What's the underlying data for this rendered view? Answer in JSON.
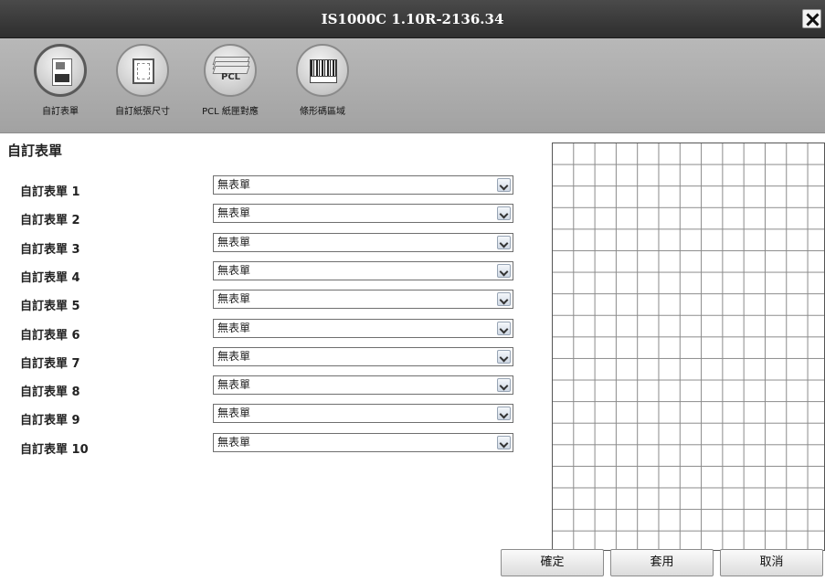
{
  "window": {
    "title": "IS1000C 1.10R-2136.34"
  },
  "toolbar": {
    "items": [
      {
        "label": "自訂表單",
        "icon": "form-icon",
        "active": true
      },
      {
        "label": "自訂紙張尺寸",
        "icon": "paper-size-icon",
        "active": false
      },
      {
        "label": "PCL 紙匣對應",
        "icon": "pcl-tray-icon",
        "active": false
      },
      {
        "label": "條形碼區域",
        "icon": "barcode-icon",
        "active": false
      }
    ]
  },
  "main": {
    "section_title": "自訂表單",
    "forms": [
      {
        "label": "自訂表單 1",
        "value": "無表單"
      },
      {
        "label": "自訂表單 2",
        "value": "無表單"
      },
      {
        "label": "自訂表單 3",
        "value": "無表單"
      },
      {
        "label": "自訂表單 4",
        "value": "無表單"
      },
      {
        "label": "自訂表單 5",
        "value": "無表單"
      },
      {
        "label": "自訂表單 6",
        "value": "無表單"
      },
      {
        "label": "自訂表單 7",
        "value": "無表單"
      },
      {
        "label": "自訂表單 8",
        "value": "無表單"
      },
      {
        "label": "自訂表單 9",
        "value": "無表單"
      },
      {
        "label": "自訂表單 10",
        "value": "無表單"
      }
    ]
  },
  "buttons": {
    "ok": "確定",
    "apply": "套用",
    "cancel": "取消"
  }
}
